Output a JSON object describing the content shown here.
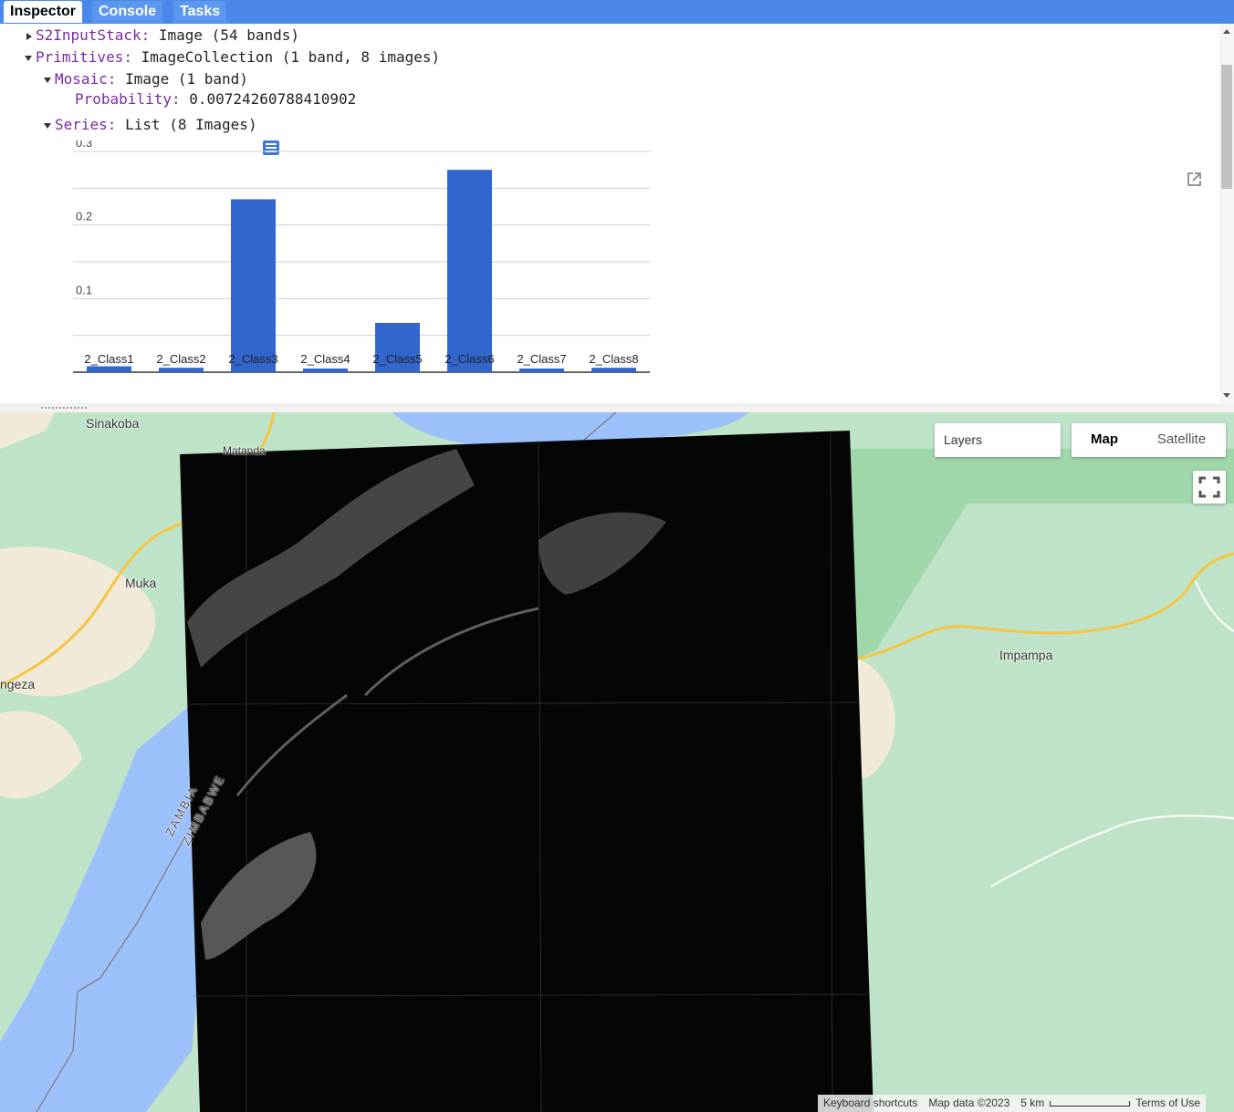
{
  "tabs": [
    {
      "label": "Inspector",
      "active": true
    },
    {
      "label": "Console",
      "active": false
    },
    {
      "label": "Tasks",
      "active": false
    }
  ],
  "inspector": {
    "rows": [
      {
        "key": "S2InputStack:",
        "value": "Image (54 bands)",
        "expanded": false
      },
      {
        "key": "Primitives:",
        "value": "ImageCollection (1 band, 8 images)",
        "expanded": true
      },
      {
        "key": "Mosaic:",
        "value": "Image (1 band)",
        "expanded": true
      },
      {
        "key": "Probability:",
        "value": "0.00724260788410902"
      },
      {
        "key": "Series:",
        "value": "List (8 Images)",
        "expanded": true
      }
    ]
  },
  "chart_data": {
    "type": "bar",
    "categories": [
      "2_Class1",
      "2_Class2",
      "2_Class3",
      "2_Class4",
      "2_Class5",
      "2_Class6",
      "2_Class7",
      "2_Class8"
    ],
    "values": [
      0.008,
      0.006,
      0.235,
      0.003,
      0.067,
      0.275,
      0.001,
      0.006
    ],
    "ylim": [
      0,
      0.3
    ],
    "yticks": [
      "0.1",
      "0.2",
      "0.3"
    ],
    "color": "#3366cc",
    "grid": true
  },
  "map": {
    "labels": [
      "Sinakoba",
      "Muka",
      "ngeza",
      "Impampa",
      "Matanda",
      "ZAMBIA",
      "ZIMBABWE"
    ],
    "layers_label": "Layers",
    "map_button": "Map",
    "satellite_button": "Satellite",
    "attribution": [
      "Keyboard shortcuts",
      "Map data ©2023",
      "5 km",
      "Terms of Use"
    ],
    "colors": {
      "water": "#9cc0f9",
      "land": "#bfe3c8",
      "road": "#f4c542",
      "tab_bar": "#4a89e8"
    }
  }
}
